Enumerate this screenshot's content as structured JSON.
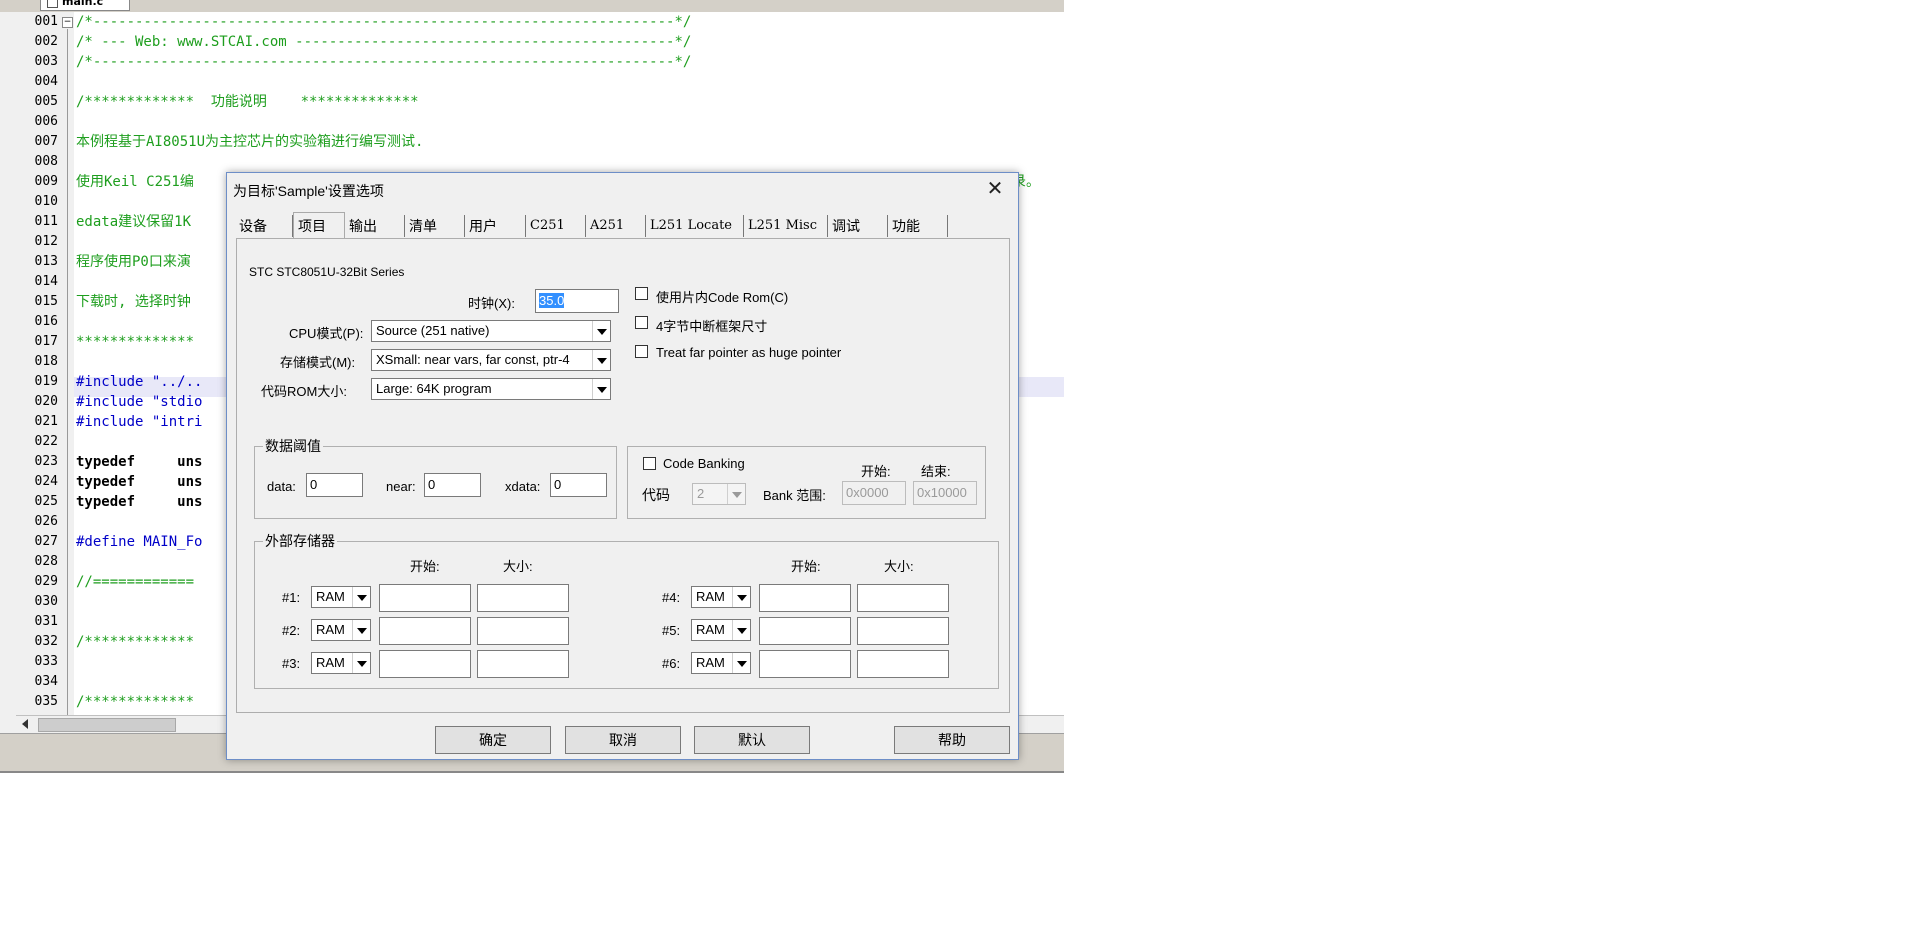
{
  "editor": {
    "file_tab": "main.c",
    "lines": [
      {
        "num": "001",
        "text": "/*---------------------------------------------------------------------*/",
        "style": "green"
      },
      {
        "num": "002",
        "text": "/* --- Web: www.STCAI.com ---------------------------------------------*/",
        "style": "green"
      },
      {
        "num": "003",
        "text": "/*---------------------------------------------------------------------*/",
        "style": "green"
      },
      {
        "num": "004",
        "text": "",
        "style": "green"
      },
      {
        "num": "005",
        "text": "/*************  功能说明    **************",
        "style": "green"
      },
      {
        "num": "006",
        "text": "",
        "style": "green"
      },
      {
        "num": "007",
        "text": "本例程基于AI8051U为主控芯片的实验箱进行编写测试.",
        "style": "green"
      },
      {
        "num": "008",
        "text": "",
        "style": "green"
      },
      {
        "num": "009",
        "text": "使用Keil C251编",
        "style": "green"
      },
      {
        "num": "010",
        "text": "",
        "style": "green"
      },
      {
        "num": "011",
        "text": "edata建议保留1K",
        "style": "green"
      },
      {
        "num": "012",
        "text": "",
        "style": "green"
      },
      {
        "num": "013",
        "text": "程序使用P0口来演",
        "style": "green"
      },
      {
        "num": "014",
        "text": "",
        "style": "green"
      },
      {
        "num": "015",
        "text": "下载时, 选择时钟",
        "style": "green"
      },
      {
        "num": "016",
        "text": "",
        "style": "green"
      },
      {
        "num": "017",
        "text": "**************",
        "style": "green"
      },
      {
        "num": "018",
        "text": "",
        "style": "green"
      },
      {
        "num": "019",
        "text": "#include \"../..",
        "style": "blue"
      },
      {
        "num": "020",
        "text": "#include \"stdio",
        "style": "blue"
      },
      {
        "num": "021",
        "text": "#include \"intri",
        "style": "blue"
      },
      {
        "num": "022",
        "text": "",
        "style": "dark"
      },
      {
        "num": "023",
        "text": "typedef     uns",
        "style": "dark"
      },
      {
        "num": "024",
        "text": "typedef     uns",
        "style": "dark"
      },
      {
        "num": "025",
        "text": "typedef     uns",
        "style": "dark"
      },
      {
        "num": "026",
        "text": "",
        "style": "dark"
      },
      {
        "num": "027",
        "text": "#define MAIN_Fo",
        "style": "blue"
      },
      {
        "num": "028",
        "text": "",
        "style": "dark"
      },
      {
        "num": "029",
        "text": "//============",
        "style": "green"
      },
      {
        "num": "030",
        "text": "",
        "style": "dark"
      },
      {
        "num": "031",
        "text": "",
        "style": "dark"
      },
      {
        "num": "032",
        "text": "/*************",
        "style": "green"
      },
      {
        "num": "033",
        "text": "",
        "style": "dark"
      },
      {
        "num": "034",
        "text": "",
        "style": "dark"
      },
      {
        "num": "035",
        "text": "/*************",
        "style": "green"
      }
    ],
    "line9_tail": "录。"
  },
  "dialog": {
    "title": "为目标'Sample'设置选项",
    "close_glyph": "✕",
    "tabs": [
      "设备",
      "项目",
      "输出",
      "清单",
      "用户",
      "C251",
      "A251",
      "L251 Locate",
      "L251 Misc",
      "调试",
      "功能"
    ],
    "active_tab": 1,
    "device": "STC STC8051U-32Bit Series",
    "clock_label": "时钟(X):",
    "clock_value": "35.0",
    "cpu_mode_label": "CPU模式(P):",
    "cpu_mode_value": "Source (251 native)",
    "memory_model_label": "存储模式(M):",
    "memory_model_value": "XSmall: near vars, far const, ptr-4",
    "code_rom_label": "代码ROM大小:",
    "code_rom_value": "Large: 64K program",
    "options": [
      {
        "label": "使用片内Code Rom(C)",
        "checked": false
      },
      {
        "label": "4字节中断框架尺寸",
        "checked": false
      },
      {
        "label": "Treat far pointer as huge pointer",
        "checked": false
      }
    ],
    "data_threshold": {
      "title": "数据阈值",
      "data_label": "data:",
      "data_value": "0",
      "near_label": "near:",
      "near_value": "0",
      "xdata_label": "xdata:",
      "xdata_value": "0"
    },
    "code_banking": {
      "label": "Code Banking",
      "checked": false,
      "start_label": "开始:",
      "end_label": "结束:",
      "code_label": "代码",
      "banks_value": "2",
      "bank_range_label": "Bank 范围:",
      "start_value": "0x0000",
      "end_value": "0x10000"
    },
    "external_memory": {
      "title": "外部存储器",
      "start_label": "开始:",
      "size_label": "大小:",
      "rows": [
        {
          "label": "#1:",
          "type": "RAM",
          "start": "",
          "size": ""
        },
        {
          "label": "#2:",
          "type": "RAM",
          "start": "",
          "size": ""
        },
        {
          "label": "#3:",
          "type": "RAM",
          "start": "",
          "size": ""
        },
        {
          "label": "#4:",
          "type": "RAM",
          "start": "",
          "size": ""
        },
        {
          "label": "#5:",
          "type": "RAM",
          "start": "",
          "size": ""
        },
        {
          "label": "#6:",
          "type": "RAM",
          "start": "",
          "size": ""
        }
      ]
    },
    "buttons": {
      "ok": "确定",
      "cancel": "取消",
      "defaults": "默认",
      "help": "帮助"
    }
  }
}
